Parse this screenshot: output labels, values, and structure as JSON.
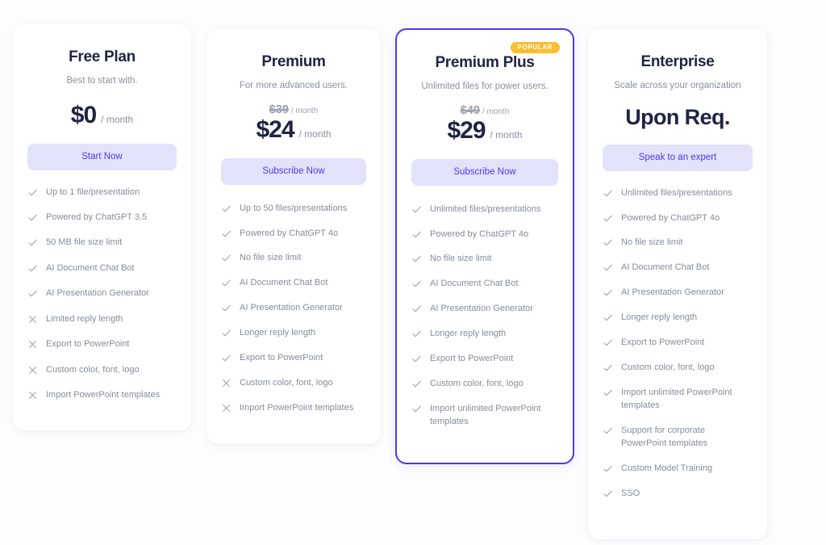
{
  "theme": {
    "page_background": "#fdfdfe",
    "card_background": "#ffffff",
    "accent": "#4a3aee",
    "button_background": "#e3e2fb",
    "badge_background": "#fcbd2e",
    "heading_color": "#1f2344",
    "muted_text": "#868b9e"
  },
  "plans": [
    {
      "id": "free",
      "name": "Free Plan",
      "tagline": "Best to start with.",
      "old_price": null,
      "old_price_period": null,
      "price": "$0",
      "price_period": "/ month",
      "cta_label": "Start Now",
      "badge": null,
      "features": [
        {
          "icon": "check-icon",
          "included": true,
          "label": "Up to 1 file/presentation"
        },
        {
          "icon": "check-icon",
          "included": true,
          "label": "Powered by ChatGPT 3.5"
        },
        {
          "icon": "check-icon",
          "included": true,
          "label": "50 MB file size limit"
        },
        {
          "icon": "check-icon",
          "included": true,
          "label": "AI Document Chat Bot"
        },
        {
          "icon": "check-icon",
          "included": true,
          "label": "AI Presentation Generator"
        },
        {
          "icon": "cross-icon",
          "included": false,
          "label": "Limited reply length"
        },
        {
          "icon": "cross-icon",
          "included": false,
          "label": "Export to PowerPoint"
        },
        {
          "icon": "cross-icon",
          "included": false,
          "label": "Custom color, font, logo"
        },
        {
          "icon": "cross-icon",
          "included": false,
          "label": "Import PowerPoint templates"
        }
      ]
    },
    {
      "id": "premium",
      "name": "Premium",
      "tagline": "For more advanced users.",
      "old_price": "$39",
      "old_price_period": "/ month",
      "price": "$24",
      "price_period": "/ month",
      "cta_label": "Subscribe Now",
      "badge": null,
      "features": [
        {
          "icon": "check-icon",
          "included": true,
          "label": "Up to 50 files/presentations"
        },
        {
          "icon": "check-icon",
          "included": true,
          "label": "Powered by ChatGPT 4o"
        },
        {
          "icon": "check-icon",
          "included": true,
          "label": "No file size limit"
        },
        {
          "icon": "check-icon",
          "included": true,
          "label": "AI Document Chat Bot"
        },
        {
          "icon": "check-icon",
          "included": true,
          "label": "AI Presentation Generator"
        },
        {
          "icon": "check-icon",
          "included": true,
          "label": "Longer reply length"
        },
        {
          "icon": "check-icon",
          "included": true,
          "label": "Export to PowerPoint"
        },
        {
          "icon": "cross-icon",
          "included": false,
          "label": "Custom color, font, logo"
        },
        {
          "icon": "cross-icon",
          "included": false,
          "label": "Import PowerPoint templates"
        }
      ]
    },
    {
      "id": "premium-plus",
      "name": "Premium Plus",
      "tagline": "Unlimited files for power users.",
      "old_price": "$49",
      "old_price_period": "/ month",
      "price": "$29",
      "price_period": "/ month",
      "cta_label": "Subscribe Now",
      "badge": "POPULAR",
      "features": [
        {
          "icon": "check-icon",
          "included": true,
          "label": "Unlimited files/presentations"
        },
        {
          "icon": "check-icon",
          "included": true,
          "label": "Powered by ChatGPT 4o"
        },
        {
          "icon": "check-icon",
          "included": true,
          "label": "No file size limit"
        },
        {
          "icon": "check-icon",
          "included": true,
          "label": "AI Document Chat Bot"
        },
        {
          "icon": "check-icon",
          "included": true,
          "label": "AI Presentation Generator"
        },
        {
          "icon": "check-icon",
          "included": true,
          "label": "Longer reply length"
        },
        {
          "icon": "check-icon",
          "included": true,
          "label": "Export to PowerPoint"
        },
        {
          "icon": "check-icon",
          "included": true,
          "label": "Custom color, font, logo"
        },
        {
          "icon": "check-icon",
          "included": true,
          "label": "Import unlimited PowerPoint templates"
        }
      ]
    },
    {
      "id": "enterprise",
      "name": "Enterprise",
      "tagline": "Scale across your organization",
      "old_price": null,
      "old_price_period": null,
      "price": "Upon Req.",
      "price_period": null,
      "cta_label": "Speak to an expert",
      "badge": null,
      "features": [
        {
          "icon": "check-icon",
          "included": true,
          "label": "Unlimited files/presentations"
        },
        {
          "icon": "check-icon",
          "included": true,
          "label": "Powered by ChatGPT 4o"
        },
        {
          "icon": "check-icon",
          "included": true,
          "label": "No file size limit"
        },
        {
          "icon": "check-icon",
          "included": true,
          "label": "AI Document Chat Bot"
        },
        {
          "icon": "check-icon",
          "included": true,
          "label": "AI Presentation Generator"
        },
        {
          "icon": "check-icon",
          "included": true,
          "label": "Longer reply length"
        },
        {
          "icon": "check-icon",
          "included": true,
          "label": "Export to PowerPoint"
        },
        {
          "icon": "check-icon",
          "included": true,
          "label": "Custom color, font, logo"
        },
        {
          "icon": "check-icon",
          "included": true,
          "label": "Import unlimited PowerPoint templates"
        },
        {
          "icon": "check-icon",
          "included": true,
          "label": "Support for corporate PowerPoint templates"
        },
        {
          "icon": "check-icon",
          "included": true,
          "label": "Custom Model Training"
        },
        {
          "icon": "check-icon",
          "included": true,
          "label": "SSO"
        }
      ]
    }
  ]
}
